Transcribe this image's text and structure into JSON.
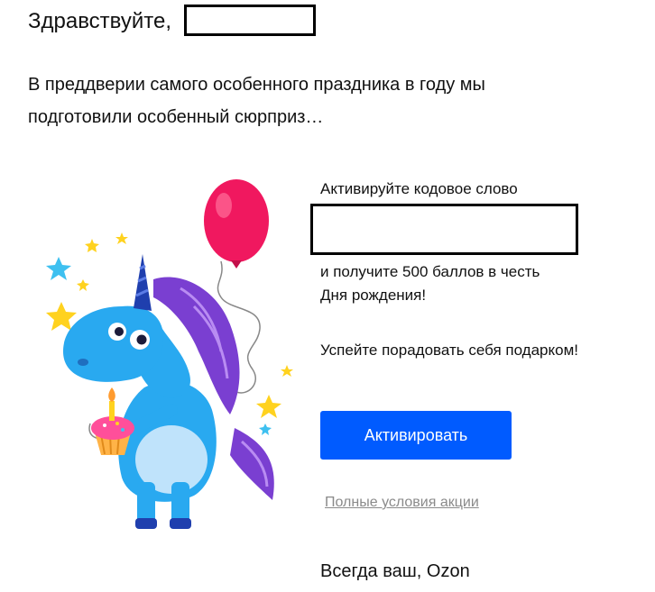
{
  "email": {
    "greeting": "Здравствуйте,",
    "intro_line_1": "В преддверии самого особенного праздника в году мы",
    "intro_line_2": "подготовили особенный сюрприз…",
    "offer": {
      "title": "Активируйте кодовое слово",
      "line_1": "и получите 500 баллов в честь",
      "line_2": "Дня рождения!",
      "hurry": "Успейте порадовать себя подарком!"
    },
    "button_label": "Активировать",
    "terms_link": "Полные условия акции",
    "signature": "Всегда ваш, Ozon"
  },
  "colors": {
    "accent": "#005bff",
    "link": "#8a8a8a",
    "unicorn_body": "#29a9f0",
    "unicorn_mane": "#7a3fd1",
    "balloon": "#f0185f",
    "star": "#ffd21f",
    "star_alt": "#3ec0f0"
  },
  "illustration": {
    "icon": "unicorn-illustration"
  }
}
